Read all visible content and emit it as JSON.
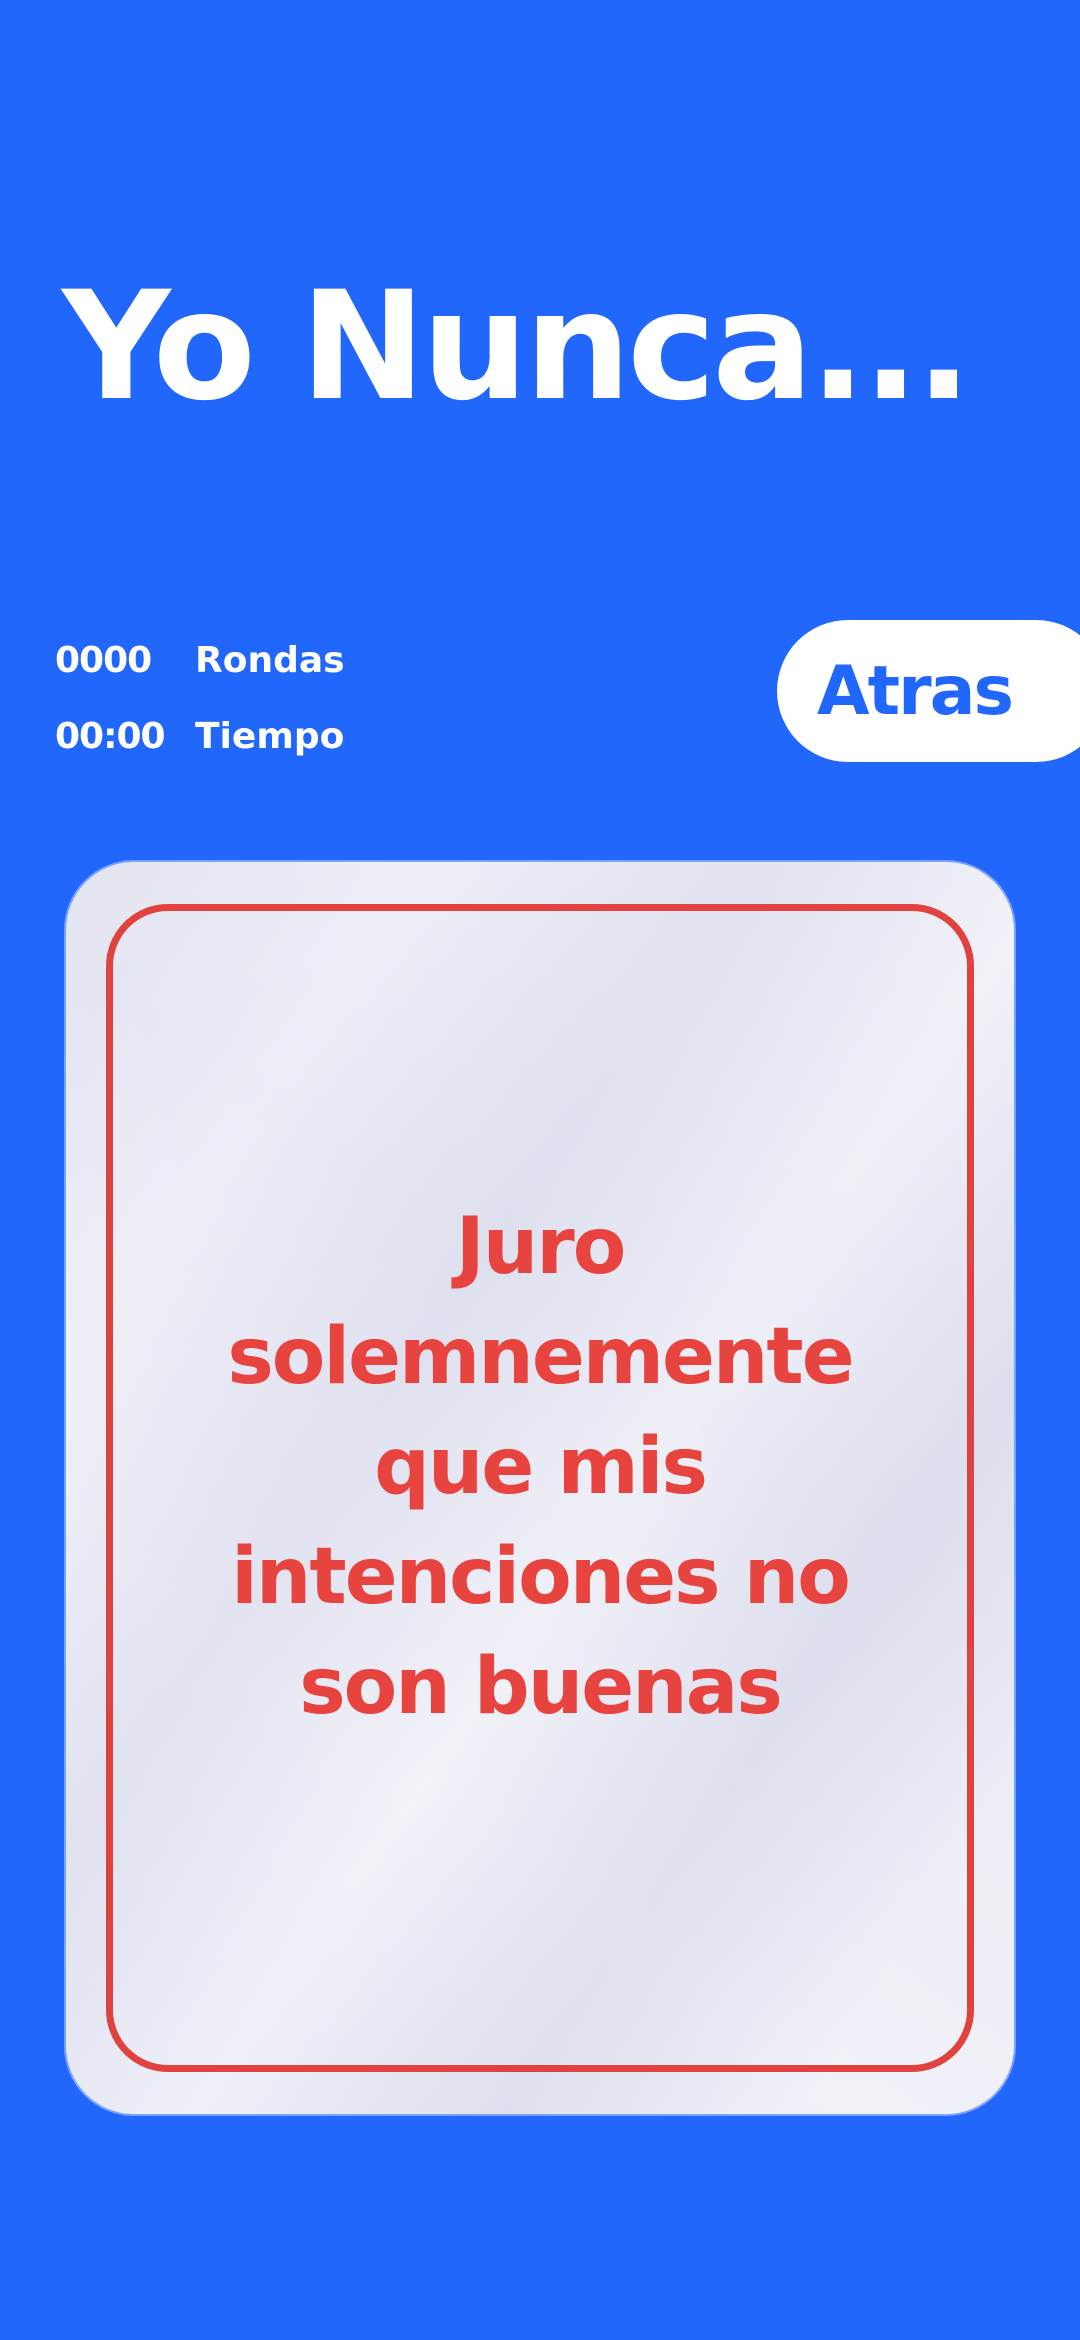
{
  "app": {
    "title": "Yo Nunca..."
  },
  "stats": {
    "rounds_value": "0000",
    "rounds_label": "Rondas",
    "time_value": "00:00",
    "time_label": "Tiempo"
  },
  "navigation": {
    "back_label": "Atras"
  },
  "card": {
    "text": "Juro solemnemente que mis intenciones no son buenas"
  },
  "colors": {
    "background": "#2167fb",
    "card_accent": "#e0433f",
    "card_background": "#e9e9f4"
  }
}
